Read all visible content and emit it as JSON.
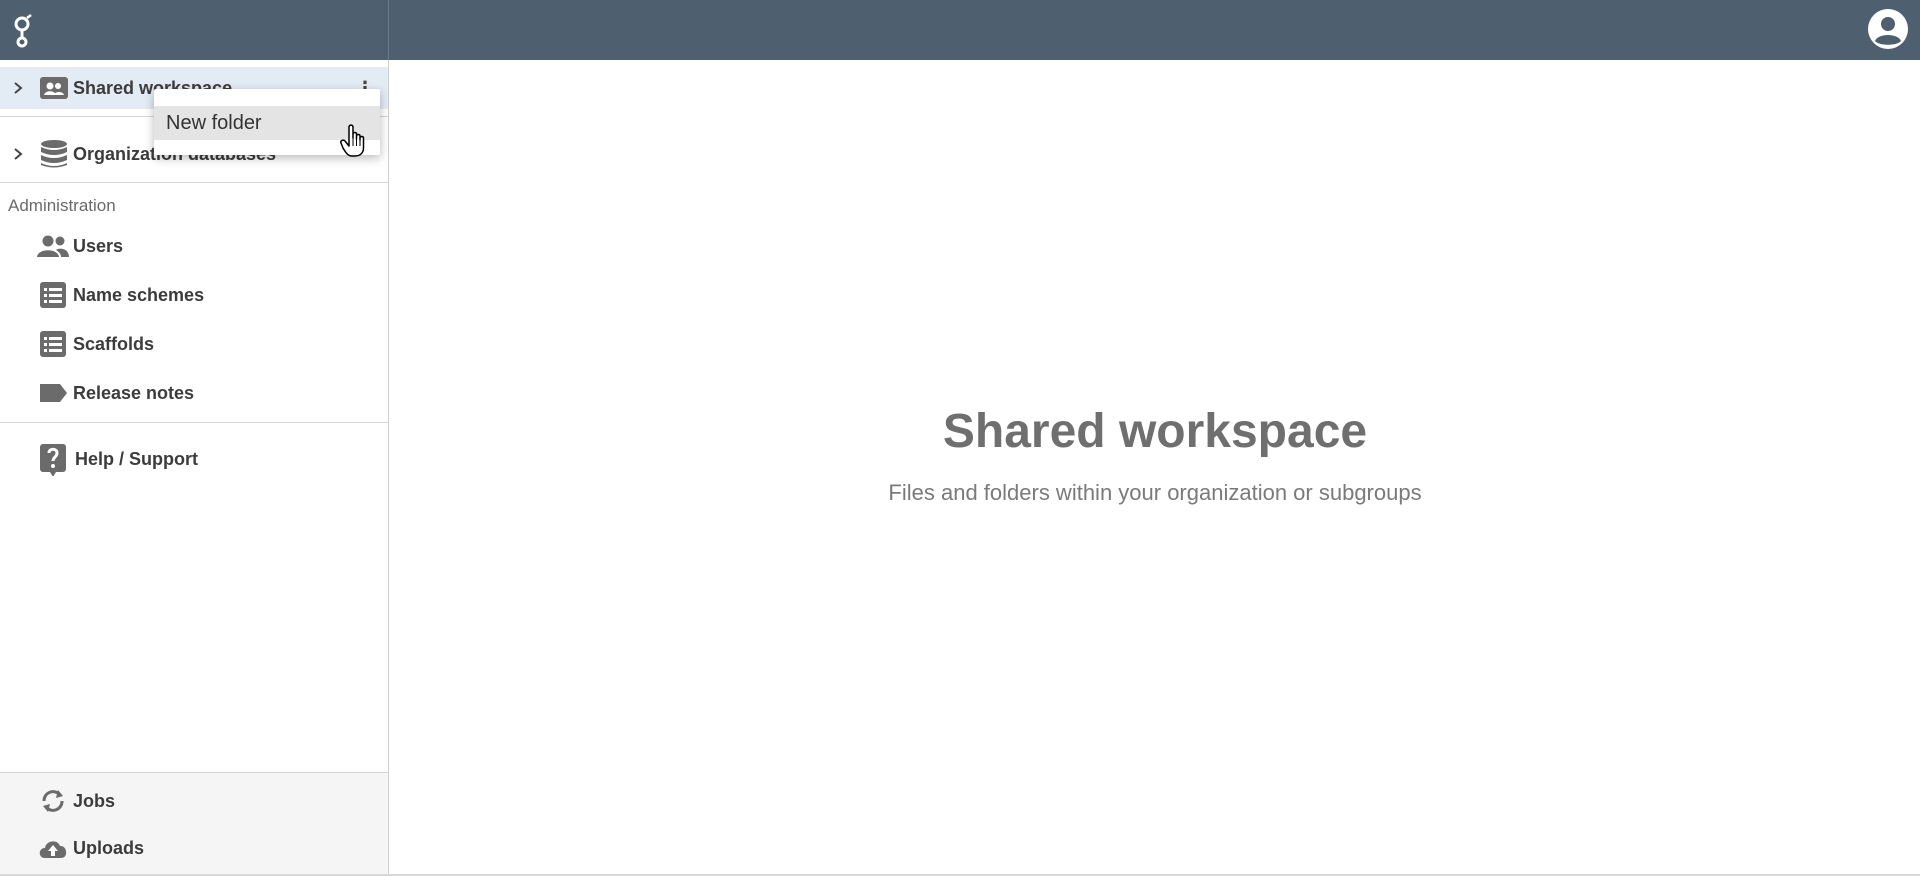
{
  "sidebar": {
    "tree": [
      {
        "label": "Shared workspace",
        "icon": "shared-workspace-icon",
        "selected": true
      },
      {
        "label": "Organization databases",
        "icon": "database-icon",
        "selected": false
      }
    ],
    "admin_title": "Administration",
    "admin_items": [
      {
        "label": "Users",
        "icon": "users-icon"
      },
      {
        "label": "Name schemes",
        "icon": "list-icon"
      },
      {
        "label": "Scaffolds",
        "icon": "list-icon"
      },
      {
        "label": "Release notes",
        "icon": "tag-icon"
      }
    ],
    "help": {
      "label": "Help / Support",
      "icon": "help-icon"
    },
    "bottom_items": [
      {
        "label": "Jobs",
        "icon": "sync-icon"
      },
      {
        "label": "Uploads",
        "icon": "cloud-upload-icon"
      }
    ]
  },
  "context_menu": {
    "items": [
      {
        "label": "New folder"
      }
    ]
  },
  "main": {
    "title": "Shared workspace",
    "subtitle": "Files and folders within your organization or subgroups"
  },
  "colors": {
    "topbar": "#4e5f70",
    "selected_row": "#e3ebf5",
    "icon": "#6b6b6b"
  }
}
